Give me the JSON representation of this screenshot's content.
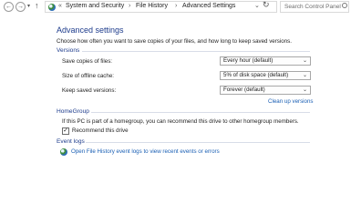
{
  "address_bar": {
    "breadcrumbs": [
      {
        "label": "System and Security"
      },
      {
        "label": "File History"
      },
      {
        "label": "Advanced Settings"
      }
    ],
    "search_placeholder": "Search Control Panel"
  },
  "page": {
    "title": "Advanced settings",
    "intro": "Choose how often you want to save copies of your files, and how long to keep saved versions."
  },
  "versions": {
    "header": "Versions",
    "rows": [
      {
        "label": "Save copies of files:",
        "value": "Every hour (default)"
      },
      {
        "label": "Size of offline cache:",
        "value": "5% of disk space (default)"
      },
      {
        "label": "Keep saved versions:",
        "value": "Forever (default)"
      }
    ],
    "cleanup_link": "Clean up versions"
  },
  "homegroup": {
    "header": "HomeGroup",
    "text": "If this PC is part of a homegroup, you can recommend this drive to other homegroup members.",
    "checkbox_label": "Recommend this drive",
    "checked": true
  },
  "event_logs": {
    "header": "Event logs",
    "link": "Open File History event logs to view recent events or errors"
  }
}
